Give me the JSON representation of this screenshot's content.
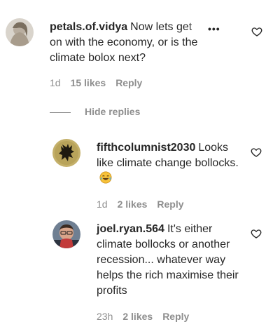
{
  "comments": [
    {
      "username": "petals.of.vidya",
      "text": "Now lets get on with the economy, or is the climate bolox next?",
      "time": "1d",
      "likes": "15 likes",
      "reply": "Reply",
      "avatar_icon": "profile-photo"
    }
  ],
  "thread": {
    "hide_replies_label": "Hide replies"
  },
  "replies": [
    {
      "username": "fifthcolumnist2030",
      "text": "Looks like climate change bollocks.",
      "emoji": "face-with-tears-of-joy",
      "time": "1d",
      "likes": "2 likes",
      "reply": "Reply",
      "avatar_icon": "profile-photo"
    },
    {
      "username": "joel.ryan.564",
      "text": "It's either climate bollocks or another recession... whatever way helps the rich maximise their profits",
      "time": "23h",
      "likes": "2 likes",
      "reply": "Reply",
      "avatar_icon": "profile-photo"
    }
  ],
  "icons": {
    "like": "heart-outline-icon",
    "more": "more-options-icon"
  },
  "colors": {
    "text": "#262626",
    "secondary": "#8e8e8e",
    "background": "#ffffff"
  }
}
